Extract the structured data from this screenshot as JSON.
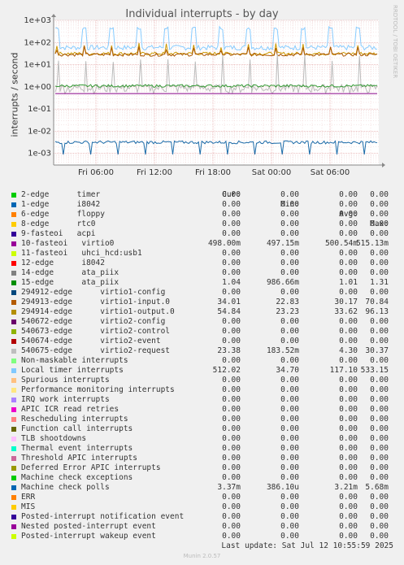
{
  "chart_data": {
    "type": "line",
    "title": "Individual interrupts - by day",
    "ylabel": "interrupts / second",
    "yscale": "log",
    "ylim": [
      0.0003,
      1000
    ],
    "yticks": [
      "1e+03",
      "1e+02",
      "1e+01",
      "1e+00",
      "1e-01",
      "1e-02",
      "1e-03"
    ],
    "xticks": [
      "Fri 06:00",
      "Fri 12:00",
      "Fri 18:00",
      "Sat 00:00",
      "Sat 06:00"
    ],
    "grid": true,
    "series": [
      {
        "name": "Local timer interrupts",
        "color": "#88ccff",
        "base": 60,
        "spike": 533.15
      },
      {
        "name": "294914-edge virtio1-output.0",
        "color": "#cc9900",
        "base": 33.62,
        "spike": 96.13
      },
      {
        "name": "294913-edge virtio1-input.0",
        "color": "#aa5500",
        "base": 30.17,
        "spike": 70.84
      },
      {
        "name": "540675-edge virtio2-request",
        "color": "#bbbbbb",
        "base": 1.0,
        "spike": 30.37
      },
      {
        "name": "15-edge ata_piix",
        "color": "#339933",
        "base": 1.01,
        "spike": 1.31
      },
      {
        "name": "10-fasteoi virtio0",
        "color": "#880088",
        "base": 0.5005,
        "spike": 0.515
      },
      {
        "name": "Machine check polls",
        "color": "#1a6aa8",
        "base": 0.0032,
        "spike": 0.0057
      }
    ]
  },
  "side_text": "RRDTOOL / TOBI OETIKER",
  "legend": {
    "headers": [
      "Cur:",
      "Min:",
      "Avg:",
      "Max:"
    ],
    "rows": [
      {
        "name": "2-edge      timer",
        "color": "#00cc00",
        "cur": "0.00",
        "min": "0.00",
        "avg": "0.00",
        "max": "0.00"
      },
      {
        "name": "1-edge      i8042",
        "color": "#0066b3",
        "cur": "0.00",
        "min": "0.00",
        "avg": "0.00",
        "max": "0.00"
      },
      {
        "name": "6-edge      floppy",
        "color": "#ff8000",
        "cur": "0.00",
        "min": "0.00",
        "avg": "0.00",
        "max": "0.00"
      },
      {
        "name": "8-edge      rtc0",
        "color": "#ffcc00",
        "cur": "0.00",
        "min": "0.00",
        "avg": "0.00",
        "max": "0.00"
      },
      {
        "name": "9-fasteoi   acpi",
        "color": "#330099",
        "cur": "0.00",
        "min": "0.00",
        "avg": "0.00",
        "max": "0.00"
      },
      {
        "name": "10-fasteoi   virtio0",
        "color": "#990099",
        "cur": "498.00m",
        "min": "497.15m",
        "avg": "500.54m",
        "max": "515.13m"
      },
      {
        "name": "11-fasteoi   uhci_hcd:usb1",
        "color": "#ccff00",
        "cur": "0.00",
        "min": "0.00",
        "avg": "0.00",
        "max": "0.00"
      },
      {
        "name": "12-edge      i8042",
        "color": "#ff0000",
        "cur": "0.00",
        "min": "0.00",
        "avg": "0.00",
        "max": "0.00"
      },
      {
        "name": "14-edge      ata_piix",
        "color": "#808080",
        "cur": "0.00",
        "min": "0.00",
        "avg": "0.00",
        "max": "0.00"
      },
      {
        "name": "15-edge      ata_piix",
        "color": "#008f00",
        "cur": "1.04",
        "min": "986.66m",
        "avg": "1.01",
        "max": "1.31"
      },
      {
        "name": "294912-edge      virtio1-config",
        "color": "#00487d",
        "cur": "0.00",
        "min": "0.00",
        "avg": "0.00",
        "max": "0.00"
      },
      {
        "name": "294913-edge      virtio1-input.0",
        "color": "#b35a00",
        "cur": "34.01",
        "min": "22.83",
        "avg": "30.17",
        "max": "70.84"
      },
      {
        "name": "294914-edge      virtio1-output.0",
        "color": "#b38f00",
        "cur": "54.84",
        "min": "23.23",
        "avg": "33.62",
        "max": "96.13"
      },
      {
        "name": "540672-edge      virtio2-config",
        "color": "#6b006b",
        "cur": "0.00",
        "min": "0.00",
        "avg": "0.00",
        "max": "0.00"
      },
      {
        "name": "540673-edge      virtio2-control",
        "color": "#8fb300",
        "cur": "0.00",
        "min": "0.00",
        "avg": "0.00",
        "max": "0.00"
      },
      {
        "name": "540674-edge      virtio2-event",
        "color": "#b30000",
        "cur": "0.00",
        "min": "0.00",
        "avg": "0.00",
        "max": "0.00"
      },
      {
        "name": "540675-edge      virtio2-request",
        "color": "#bebebe",
        "cur": "23.38",
        "min": "183.52m",
        "avg": "4.30",
        "max": "30.37"
      },
      {
        "name": "Non-maskable interrupts",
        "color": "#80ff80",
        "cur": "0.00",
        "min": "0.00",
        "avg": "0.00",
        "max": "0.00"
      },
      {
        "name": "Local timer interrupts",
        "color": "#80c9ff",
        "cur": "512.02",
        "min": "34.70",
        "avg": "117.10",
        "max": "533.15"
      },
      {
        "name": "Spurious interrupts",
        "color": "#ffc080",
        "cur": "0.00",
        "min": "0.00",
        "avg": "0.00",
        "max": "0.00"
      },
      {
        "name": "Performance monitoring interrupts",
        "color": "#ffe680",
        "cur": "0.00",
        "min": "0.00",
        "avg": "0.00",
        "max": "0.00"
      },
      {
        "name": "IRQ work interrupts",
        "color": "#aa80ff",
        "cur": "0.00",
        "min": "0.00",
        "avg": "0.00",
        "max": "0.00"
      },
      {
        "name": "APIC ICR read retries",
        "color": "#ee00cc",
        "cur": "0.00",
        "min": "0.00",
        "avg": "0.00",
        "max": "0.00"
      },
      {
        "name": "Rescheduling interrupts",
        "color": "#ff8080",
        "cur": "0.00",
        "min": "0.00",
        "avg": "0.00",
        "max": "0.00"
      },
      {
        "name": "Function call interrupts",
        "color": "#666600",
        "cur": "0.00",
        "min": "0.00",
        "avg": "0.00",
        "max": "0.00"
      },
      {
        "name": "TLB shootdowns",
        "color": "#ffbfff",
        "cur": "0.00",
        "min": "0.00",
        "avg": "0.00",
        "max": "0.00"
      },
      {
        "name": "Thermal event interrupts",
        "color": "#00ffcc",
        "cur": "0.00",
        "min": "0.00",
        "avg": "0.00",
        "max": "0.00"
      },
      {
        "name": "Threshold APIC interrupts",
        "color": "#cc6699",
        "cur": "0.00",
        "min": "0.00",
        "avg": "0.00",
        "max": "0.00"
      },
      {
        "name": "Deferred Error APIC interrupts",
        "color": "#999900",
        "cur": "0.00",
        "min": "0.00",
        "avg": "0.00",
        "max": "0.00"
      },
      {
        "name": "Machine check exceptions",
        "color": "#00cc00",
        "cur": "0.00",
        "min": "0.00",
        "avg": "0.00",
        "max": "0.00"
      },
      {
        "name": "Machine check polls",
        "color": "#0066b3",
        "cur": "3.37m",
        "min": "386.10u",
        "avg": "3.21m",
        "max": "5.68m"
      },
      {
        "name": "ERR",
        "color": "#ff8000",
        "cur": "0.00",
        "min": "0.00",
        "avg": "0.00",
        "max": "0.00"
      },
      {
        "name": "MIS",
        "color": "#ffcc00",
        "cur": "0.00",
        "min": "0.00",
        "avg": "0.00",
        "max": "0.00"
      },
      {
        "name": "Posted-interrupt notification event",
        "color": "#330099",
        "cur": "0.00",
        "min": "0.00",
        "avg": "0.00",
        "max": "0.00"
      },
      {
        "name": "Nested posted-interrupt event",
        "color": "#990099",
        "cur": "0.00",
        "min": "0.00",
        "avg": "0.00",
        "max": "0.00"
      },
      {
        "name": "Posted-interrupt wakeup event",
        "color": "#ccff00",
        "cur": "0.00",
        "min": "0.00",
        "avg": "0.00",
        "max": "0.00"
      }
    ]
  },
  "last_update": "Last update: Sat Jul 12 10:55:59 2025",
  "footer": "Munin 2.0.57"
}
